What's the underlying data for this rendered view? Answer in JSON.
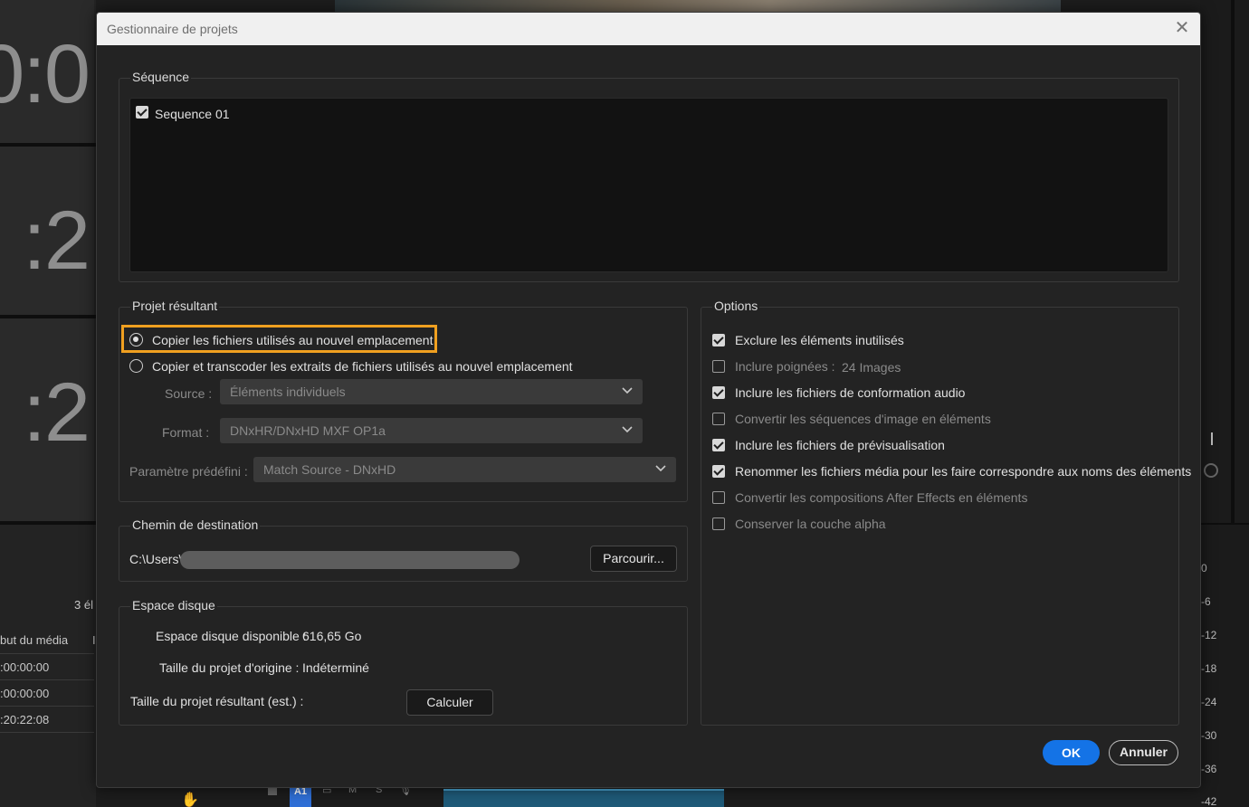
{
  "background": {
    "timecodes": [
      "0:0",
      ":2",
      ":2"
    ],
    "items_count": "3 él",
    "column_header": "but du média",
    "column_header2": "I",
    "rows": [
      ":00:00:00",
      ":00:00:00",
      ":20:22:08"
    ],
    "db_scale": [
      "0",
      "-6",
      "-12",
      "-18",
      "-24",
      "-30",
      "-36",
      "-42"
    ],
    "track_label": "A1",
    "track_buttons": [
      "M",
      "S"
    ]
  },
  "dialog": {
    "title": "Gestionnaire de projets",
    "sequence": {
      "label": "Séquence",
      "items": [
        {
          "name": "Sequence 01",
          "checked": true
        }
      ]
    },
    "resulting_project": {
      "label": "Projet résultant",
      "option_copy": "Copier les fichiers utilisés au nouvel emplacement",
      "option_transcode": "Copier et transcoder les extraits de fichiers utilisés au nouvel emplacement",
      "selected": "copy",
      "source_label": "Source :",
      "source_value": "Éléments individuels",
      "format_label": "Format :",
      "format_value": "DNxHR/DNxHD MXF OP1a",
      "preset_label": "Paramètre prédéfini :",
      "preset_value": "Match Source - DNxHD"
    },
    "destination": {
      "label": "Chemin de destination",
      "path_prefix": "C:\\Users\\",
      "browse_label": "Parcourir..."
    },
    "disk_space": {
      "label": "Espace disque",
      "available_label": "Espace disque disponible :",
      "available_value": "616,65 Go",
      "original_label": "Taille du projet d'origine :",
      "original_value": "Indéterminé",
      "resulting_label": "Taille du projet résultant (est.) :",
      "compute_label": "Calculer"
    },
    "options": {
      "label": "Options",
      "items": [
        {
          "label": "Exclure les éléments inutilisés",
          "checked": true,
          "enabled": true
        },
        {
          "label": "Inclure poignées :",
          "checked": false,
          "enabled": false,
          "value": "24 Images"
        },
        {
          "label": "Inclure les fichiers de conformation audio",
          "checked": true,
          "enabled": true
        },
        {
          "label": "Convertir les séquences d'image en éléments",
          "checked": false,
          "enabled": false
        },
        {
          "label": "Inclure les fichiers de prévisualisation",
          "checked": true,
          "enabled": true
        },
        {
          "label": "Renommer les fichiers média pour les faire correspondre aux noms des éléments",
          "checked": true,
          "enabled": true
        },
        {
          "label": "Convertir les compositions After Effects en éléments",
          "checked": false,
          "enabled": false
        },
        {
          "label": "Conserver la couche alpha",
          "checked": false,
          "enabled": false
        }
      ]
    },
    "ok_label": "OK",
    "cancel_label": "Annuler"
  }
}
